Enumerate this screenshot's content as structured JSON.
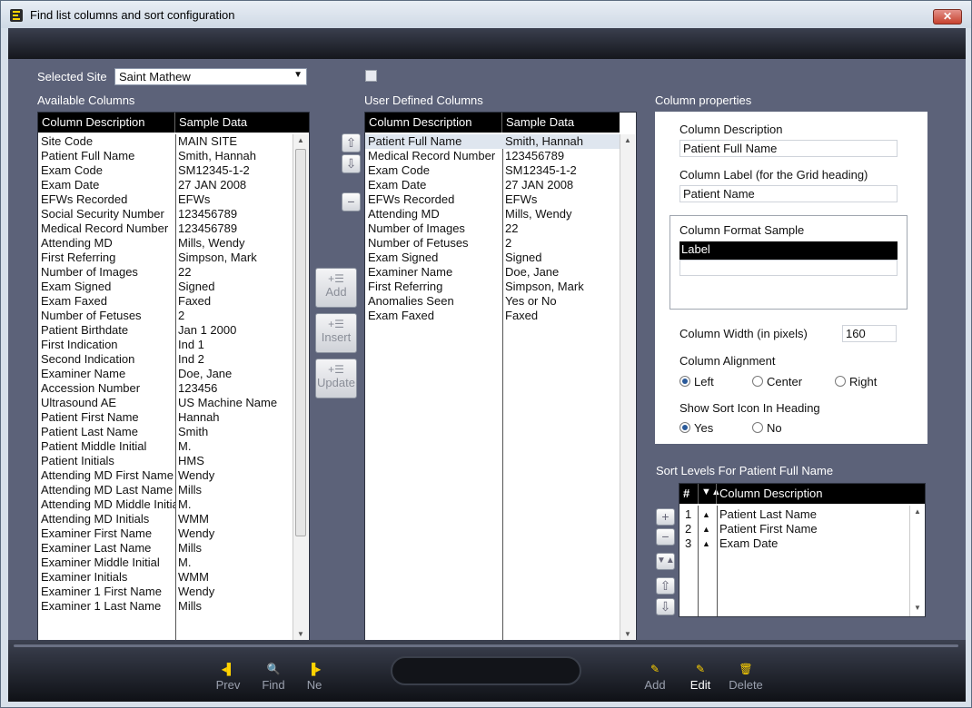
{
  "window": {
    "title": "Find list columns and sort configuration",
    "close_label": "✕"
  },
  "site": {
    "label": "Selected Site",
    "value": "Saint Mathew"
  },
  "available": {
    "label": "Available Columns",
    "col1": "Column Description",
    "col2": "Sample Data",
    "rows": [
      [
        "Site Code",
        "MAIN SITE"
      ],
      [
        "Patient Full Name",
        "Smith, Hannah"
      ],
      [
        "Exam Code",
        "SM12345-1-2"
      ],
      [
        "Exam Date",
        "27 JAN 2008"
      ],
      [
        "EFWs Recorded",
        "EFWs"
      ],
      [
        "Social Security Number",
        "123456789"
      ],
      [
        "Medical Record Number",
        "123456789"
      ],
      [
        "Attending MD",
        "Mills, Wendy"
      ],
      [
        "First Referring",
        "Simpson, Mark"
      ],
      [
        "Number of Images",
        "22"
      ],
      [
        "Exam Signed",
        "Signed"
      ],
      [
        "Exam Faxed",
        "Faxed"
      ],
      [
        "Number of Fetuses",
        "2"
      ],
      [
        "Patient Birthdate",
        "Jan 1 2000"
      ],
      [
        "First Indication",
        "Ind 1"
      ],
      [
        "Second Indication",
        "Ind 2"
      ],
      [
        "Examiner Name",
        "Doe, Jane"
      ],
      [
        "Accession Number",
        "123456"
      ],
      [
        "Ultrasound AE",
        "US Machine Name"
      ],
      [
        "Patient First Name",
        "Hannah"
      ],
      [
        "Patient Last Name",
        "Smith"
      ],
      [
        "Patient Middle Initial",
        "M."
      ],
      [
        "Patient Initials",
        "HMS"
      ],
      [
        "Attending MD First Name",
        "Wendy"
      ],
      [
        "Attending MD Last Name",
        "Mills"
      ],
      [
        "Attending MD Middle Initial",
        "M."
      ],
      [
        "Attending MD Initials",
        "WMM"
      ],
      [
        "Examiner First Name",
        "Wendy"
      ],
      [
        "Examiner Last Name",
        "Mills"
      ],
      [
        "Examiner Middle Initial",
        "M."
      ],
      [
        "Examiner Initials",
        "WMM"
      ],
      [
        "Examiner 1 First Name",
        "Wendy"
      ],
      [
        "Examiner 1 Last Name",
        "Mills"
      ]
    ]
  },
  "user_defined": {
    "label": "User Defined Columns",
    "col1": "Column Description",
    "col2": "Sample Data",
    "rows": [
      [
        "Patient Full Name",
        "Smith, Hannah"
      ],
      [
        "Medical Record Number",
        "123456789"
      ],
      [
        "Exam Code",
        "SM12345-1-2"
      ],
      [
        "Exam Date",
        "27 JAN 2008"
      ],
      [
        "EFWs Recorded",
        "EFWs"
      ],
      [
        "Attending MD",
        "Mills, Wendy"
      ],
      [
        "Number of Images",
        "22"
      ],
      [
        "Number of Fetuses",
        "2"
      ],
      [
        "Exam Signed",
        "Signed"
      ],
      [
        "Examiner Name",
        "Doe, Jane"
      ],
      [
        "First Referring",
        "Simpson, Mark"
      ],
      [
        "Anomalies Seen",
        "Yes or No"
      ],
      [
        "Exam Faxed",
        "Faxed"
      ]
    ]
  },
  "actions": {
    "add": "Add",
    "insert": "Insert",
    "update": "Update"
  },
  "properties": {
    "title": "Column properties",
    "desc_label": "Column Description",
    "desc_value": "Patient Full Name",
    "grid_label": "Column Label (for the Grid heading)",
    "grid_value": "Patient Name",
    "format_label": "Column Format Sample",
    "format_value": "Label",
    "width_label": "Column Width (in pixels)",
    "width_value": "160",
    "align_label": "Column Alignment",
    "align_left": "Left",
    "align_center": "Center",
    "align_right": "Right",
    "sort_icon_label": "Show Sort Icon In Heading",
    "yes": "Yes",
    "no": "No"
  },
  "sort_levels": {
    "title": "Sort Levels For Patient Full Name",
    "col_num": "#",
    "col_desc": "Column Description",
    "rows": [
      [
        "1",
        "Patient Last Name"
      ],
      [
        "2",
        "Patient First Name"
      ],
      [
        "3",
        "Exam Date"
      ]
    ]
  },
  "footer": {
    "prev": "Prev",
    "find": "Find",
    "next": "Ne",
    "add": "Add",
    "edit": "Edit",
    "delete": "Delete"
  }
}
